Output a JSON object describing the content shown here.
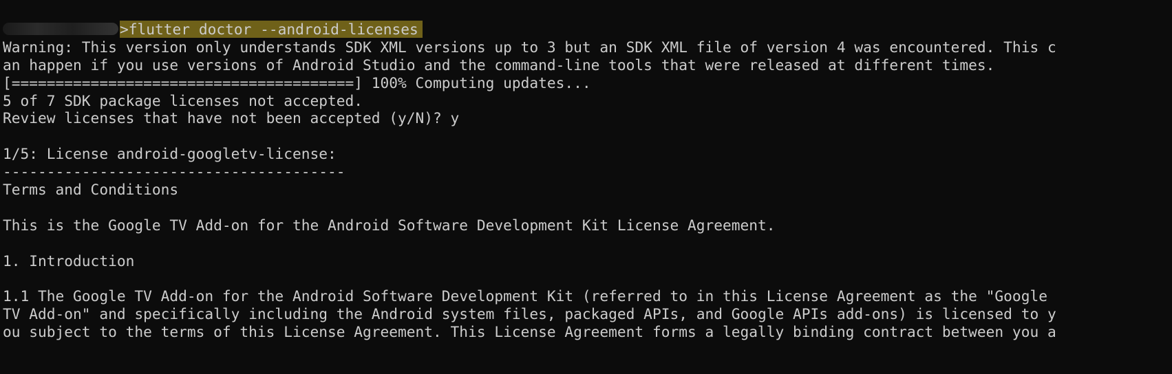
{
  "terminal": {
    "prompt_symbol": ">",
    "command": "flutter doctor --android-licenses",
    "lines": [
      "Warning: This version only understands SDK XML versions up to 3 but an SDK XML file of version 4 was encountered. This c",
      "an happen if you use versions of Android Studio and the command-line tools that were released at different times.",
      "[=======================================] 100% Computing updates...",
      "5 of 7 SDK package licenses not accepted.",
      "Review licenses that have not been accepted (y/N)? y",
      "",
      "1/5: License android-googletv-license:",
      "---------------------------------------",
      "Terms and Conditions",
      "",
      "This is the Google TV Add-on for the Android Software Development Kit License Agreement.",
      "",
      "1. Introduction",
      "",
      "1.1 The Google TV Add-on for the Android Software Development Kit (referred to in this License Agreement as the \"Google",
      "TV Add-on\" and specifically including the Android system files, packaged APIs, and Google APIs add-ons) is licensed to y",
      "ou subject to the terms of this License Agreement. This License Agreement forms a legally binding contract between you a"
    ]
  },
  "colors": {
    "background": "#0c0c0c",
    "text": "#cccccc",
    "command_highlight": "#7a6a1c"
  }
}
